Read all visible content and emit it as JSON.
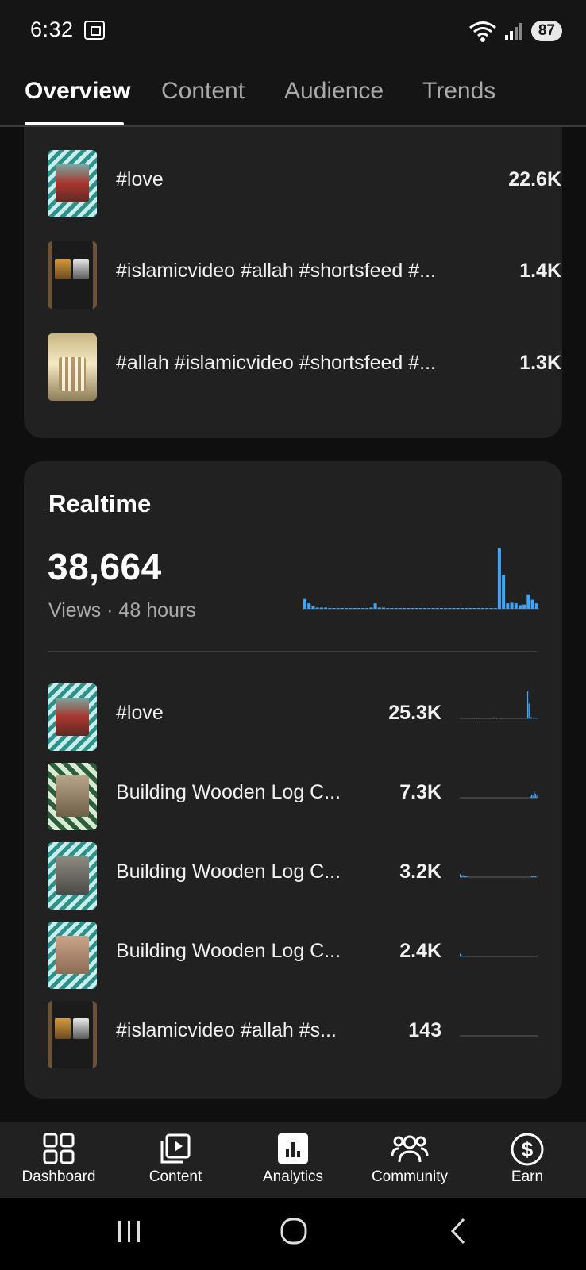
{
  "status_bar": {
    "time": "6:32",
    "battery": "87"
  },
  "tabs": [
    {
      "label": "Overview",
      "active": true
    },
    {
      "label": "Content",
      "active": false
    },
    {
      "label": "Audience",
      "active": false
    },
    {
      "label": "Trends",
      "active": false
    }
  ],
  "top_content": {
    "items": [
      {
        "title": "#love",
        "value": "22.6K"
      },
      {
        "title": "#islamicvideo #allah #shortsfeed #...",
        "value": "1.4K"
      },
      {
        "title": "#allah #islamicvideo #shortsfeed #...",
        "value": "1.3K"
      }
    ]
  },
  "realtime": {
    "heading": "Realtime",
    "views": "38,664",
    "label": "Views · 48 hours",
    "accent": "#3ea6ff",
    "bars": [
      0.16,
      0.09,
      0.04,
      0.02,
      0.02,
      0.02,
      0.01,
      0.01,
      0.0,
      0.0,
      0.0,
      0.0,
      0.0,
      0.01,
      0.01,
      0.01,
      0.02,
      0.09,
      0.02,
      0.02,
      0.01,
      0.01,
      0.01,
      0.01,
      0.01,
      0.01,
      0.01,
      0.01,
      0.01,
      0.01,
      0.01,
      0.01,
      0.01,
      0.0,
      0.0,
      0.0,
      0.0,
      0.0,
      0.0,
      0.0,
      0.01,
      0.0,
      0.0,
      0.0,
      0.0,
      0.0,
      0.0,
      1.0,
      0.56,
      0.09,
      0.1,
      0.09,
      0.06,
      0.07,
      0.24,
      0.15,
      0.09
    ],
    "items": [
      {
        "title": "#love",
        "value": "25.3K",
        "spark": [
          0,
          0,
          0,
          0,
          0,
          0,
          0,
          0,
          0,
          0,
          0,
          0.02,
          0,
          0,
          0.01,
          0,
          0,
          0,
          0,
          0,
          0,
          0,
          0,
          0,
          0,
          0,
          0.04,
          0,
          0.02,
          0,
          0,
          0,
          0,
          0,
          0,
          0,
          0,
          0,
          0,
          0,
          0,
          0,
          0,
          0,
          0,
          0,
          0,
          0,
          0,
          0,
          0,
          0,
          1.0,
          0.55,
          0.06,
          0.04,
          0.03,
          0.02,
          0.02,
          0.01
        ]
      },
      {
        "title": "Building Wooden Log C...",
        "value": "7.3K",
        "spark": [
          0,
          0,
          0,
          0,
          0,
          0,
          0,
          0,
          0,
          0,
          0,
          0,
          0,
          0,
          0,
          0,
          0,
          0,
          0,
          0,
          0,
          0,
          0,
          0,
          0,
          0,
          0,
          0,
          0,
          0,
          0,
          0,
          0,
          0,
          0,
          0,
          0,
          0,
          0,
          0,
          0,
          0,
          0,
          0,
          0,
          0,
          0,
          0,
          0,
          0,
          0,
          0,
          0,
          0,
          0.05,
          0.12,
          0.08,
          0.25,
          0.15,
          0.08
        ]
      },
      {
        "title": "Building Wooden Log C...",
        "value": "3.2K",
        "spark": [
          0.12,
          0.05,
          0.08,
          0.04,
          0.02,
          0.02,
          0.01,
          0,
          0,
          0,
          0,
          0,
          0,
          0,
          0,
          0,
          0,
          0,
          0,
          0,
          0,
          0,
          0,
          0,
          0,
          0,
          0,
          0,
          0,
          0,
          0,
          0,
          0,
          0,
          0,
          0,
          0,
          0,
          0,
          0,
          0,
          0,
          0,
          0,
          0,
          0,
          0,
          0,
          0,
          0,
          0,
          0,
          0,
          0,
          0,
          0.06,
          0.02,
          0.01,
          0.01,
          0
        ]
      },
      {
        "title": "Building Wooden Log C...",
        "value": "2.4K",
        "spark": [
          0.1,
          0.04,
          0.03,
          0.02,
          0.01,
          0,
          0,
          0,
          0,
          0,
          0,
          0,
          0,
          0,
          0,
          0,
          0,
          0,
          0,
          0,
          0,
          0,
          0,
          0,
          0,
          0,
          0,
          0,
          0,
          0,
          0,
          0,
          0,
          0,
          0,
          0,
          0,
          0,
          0,
          0,
          0,
          0,
          0,
          0,
          0,
          0,
          0,
          0,
          0,
          0,
          0,
          0,
          0,
          0,
          0,
          0,
          0,
          0,
          0,
          0
        ]
      },
      {
        "title": "#islamicvideo #allah #s...",
        "value": "143",
        "spark": [
          0,
          0,
          0,
          0,
          0,
          0,
          0,
          0,
          0,
          0,
          0,
          0,
          0,
          0,
          0,
          0,
          0,
          0,
          0,
          0,
          0,
          0,
          0,
          0,
          0,
          0,
          0,
          0,
          0,
          0,
          0,
          0,
          0,
          0,
          0,
          0,
          0,
          0,
          0,
          0,
          0,
          0,
          0,
          0,
          0,
          0,
          0,
          0,
          0,
          0,
          0,
          0,
          0,
          0,
          0,
          0,
          0,
          0,
          0,
          0
        ]
      }
    ]
  },
  "bottom_nav": [
    {
      "label": "Dashboard",
      "icon": "dashboard-icon"
    },
    {
      "label": "Content",
      "icon": "content-icon"
    },
    {
      "label": "Analytics",
      "icon": "analytics-icon",
      "active": true
    },
    {
      "label": "Community",
      "icon": "community-icon"
    },
    {
      "label": "Earn",
      "icon": "earn-icon"
    }
  ]
}
